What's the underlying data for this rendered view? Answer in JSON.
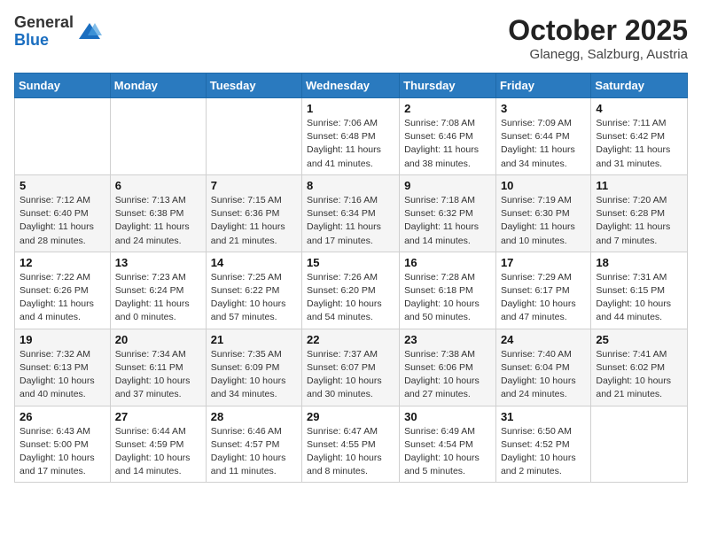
{
  "header": {
    "logo_general": "General",
    "logo_blue": "Blue",
    "title": "October 2025",
    "location": "Glanegg, Salzburg, Austria"
  },
  "days_of_week": [
    "Sunday",
    "Monday",
    "Tuesday",
    "Wednesday",
    "Thursday",
    "Friday",
    "Saturday"
  ],
  "weeks": [
    [
      {
        "day": "",
        "info": ""
      },
      {
        "day": "",
        "info": ""
      },
      {
        "day": "",
        "info": ""
      },
      {
        "day": "1",
        "info": "Sunrise: 7:06 AM\nSunset: 6:48 PM\nDaylight: 11 hours and 41 minutes."
      },
      {
        "day": "2",
        "info": "Sunrise: 7:08 AM\nSunset: 6:46 PM\nDaylight: 11 hours and 38 minutes."
      },
      {
        "day": "3",
        "info": "Sunrise: 7:09 AM\nSunset: 6:44 PM\nDaylight: 11 hours and 34 minutes."
      },
      {
        "day": "4",
        "info": "Sunrise: 7:11 AM\nSunset: 6:42 PM\nDaylight: 11 hours and 31 minutes."
      }
    ],
    [
      {
        "day": "5",
        "info": "Sunrise: 7:12 AM\nSunset: 6:40 PM\nDaylight: 11 hours and 28 minutes."
      },
      {
        "day": "6",
        "info": "Sunrise: 7:13 AM\nSunset: 6:38 PM\nDaylight: 11 hours and 24 minutes."
      },
      {
        "day": "7",
        "info": "Sunrise: 7:15 AM\nSunset: 6:36 PM\nDaylight: 11 hours and 21 minutes."
      },
      {
        "day": "8",
        "info": "Sunrise: 7:16 AM\nSunset: 6:34 PM\nDaylight: 11 hours and 17 minutes."
      },
      {
        "day": "9",
        "info": "Sunrise: 7:18 AM\nSunset: 6:32 PM\nDaylight: 11 hours and 14 minutes."
      },
      {
        "day": "10",
        "info": "Sunrise: 7:19 AM\nSunset: 6:30 PM\nDaylight: 11 hours and 10 minutes."
      },
      {
        "day": "11",
        "info": "Sunrise: 7:20 AM\nSunset: 6:28 PM\nDaylight: 11 hours and 7 minutes."
      }
    ],
    [
      {
        "day": "12",
        "info": "Sunrise: 7:22 AM\nSunset: 6:26 PM\nDaylight: 11 hours and 4 minutes."
      },
      {
        "day": "13",
        "info": "Sunrise: 7:23 AM\nSunset: 6:24 PM\nDaylight: 11 hours and 0 minutes."
      },
      {
        "day": "14",
        "info": "Sunrise: 7:25 AM\nSunset: 6:22 PM\nDaylight: 10 hours and 57 minutes."
      },
      {
        "day": "15",
        "info": "Sunrise: 7:26 AM\nSunset: 6:20 PM\nDaylight: 10 hours and 54 minutes."
      },
      {
        "day": "16",
        "info": "Sunrise: 7:28 AM\nSunset: 6:18 PM\nDaylight: 10 hours and 50 minutes."
      },
      {
        "day": "17",
        "info": "Sunrise: 7:29 AM\nSunset: 6:17 PM\nDaylight: 10 hours and 47 minutes."
      },
      {
        "day": "18",
        "info": "Sunrise: 7:31 AM\nSunset: 6:15 PM\nDaylight: 10 hours and 44 minutes."
      }
    ],
    [
      {
        "day": "19",
        "info": "Sunrise: 7:32 AM\nSunset: 6:13 PM\nDaylight: 10 hours and 40 minutes."
      },
      {
        "day": "20",
        "info": "Sunrise: 7:34 AM\nSunset: 6:11 PM\nDaylight: 10 hours and 37 minutes."
      },
      {
        "day": "21",
        "info": "Sunrise: 7:35 AM\nSunset: 6:09 PM\nDaylight: 10 hours and 34 minutes."
      },
      {
        "day": "22",
        "info": "Sunrise: 7:37 AM\nSunset: 6:07 PM\nDaylight: 10 hours and 30 minutes."
      },
      {
        "day": "23",
        "info": "Sunrise: 7:38 AM\nSunset: 6:06 PM\nDaylight: 10 hours and 27 minutes."
      },
      {
        "day": "24",
        "info": "Sunrise: 7:40 AM\nSunset: 6:04 PM\nDaylight: 10 hours and 24 minutes."
      },
      {
        "day": "25",
        "info": "Sunrise: 7:41 AM\nSunset: 6:02 PM\nDaylight: 10 hours and 21 minutes."
      }
    ],
    [
      {
        "day": "26",
        "info": "Sunrise: 6:43 AM\nSunset: 5:00 PM\nDaylight: 10 hours and 17 minutes."
      },
      {
        "day": "27",
        "info": "Sunrise: 6:44 AM\nSunset: 4:59 PM\nDaylight: 10 hours and 14 minutes."
      },
      {
        "day": "28",
        "info": "Sunrise: 6:46 AM\nSunset: 4:57 PM\nDaylight: 10 hours and 11 minutes."
      },
      {
        "day": "29",
        "info": "Sunrise: 6:47 AM\nSunset: 4:55 PM\nDaylight: 10 hours and 8 minutes."
      },
      {
        "day": "30",
        "info": "Sunrise: 6:49 AM\nSunset: 4:54 PM\nDaylight: 10 hours and 5 minutes."
      },
      {
        "day": "31",
        "info": "Sunrise: 6:50 AM\nSunset: 4:52 PM\nDaylight: 10 hours and 2 minutes."
      },
      {
        "day": "",
        "info": ""
      }
    ]
  ]
}
